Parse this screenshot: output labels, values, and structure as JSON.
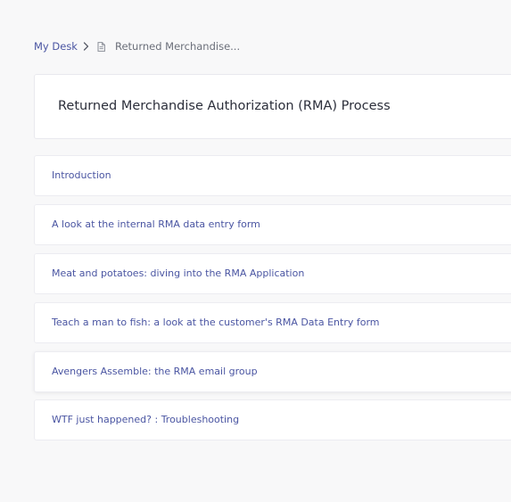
{
  "breadcrumb": {
    "root_label": "My Desk",
    "current_label": "Returned Merchandise..."
  },
  "page": {
    "title": "Returned Merchandise Authorization (RMA) Process"
  },
  "sections": [
    {
      "label": "Introduction"
    },
    {
      "label": "A look at the internal RMA data entry form"
    },
    {
      "label": "Meat and potatoes: diving into the RMA Application"
    },
    {
      "label": "Teach a man to fish: a look at the customer's RMA Data Entry form"
    },
    {
      "label": "Avengers Assemble: the RMA email group"
    },
    {
      "label": "WTF just happened? : Troubleshooting"
    }
  ],
  "icons": {
    "breadcrumb_separator": "chevron-right-icon",
    "document": "document-icon"
  },
  "colors": {
    "link": "#4a55a2",
    "title": "#2b2e3a",
    "muted": "#6b6f7a",
    "background": "#f8f8f9"
  }
}
